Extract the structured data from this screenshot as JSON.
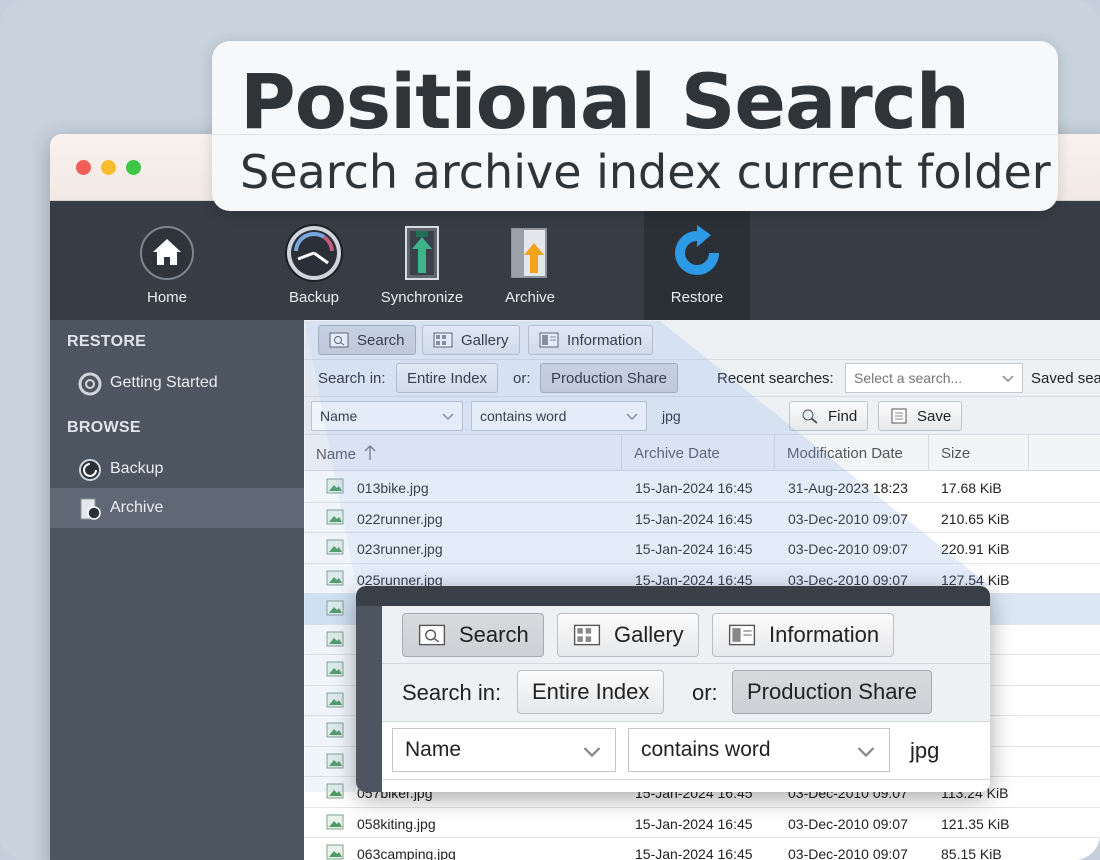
{
  "banner": {
    "title": "Positional Search",
    "subtitle": "Search archive index current folder"
  },
  "toolbar": {
    "items": [
      {
        "label": "Home",
        "icon": "home-icon"
      },
      {
        "label": "Backup",
        "icon": "backup-gauge-icon"
      },
      {
        "label": "Synchronize",
        "icon": "synchronize-icon"
      },
      {
        "label": "Archive",
        "icon": "archive-icon"
      },
      {
        "label": "Restore",
        "icon": "restore-icon"
      }
    ],
    "active": "Restore"
  },
  "sidebar": {
    "restore_heading": "RESTORE",
    "restore_items": [
      {
        "label": "Getting Started",
        "icon": "lifebuoy-icon"
      }
    ],
    "browse_heading": "BROWSE",
    "browse_items": [
      {
        "label": "Backup",
        "icon": "backup-restore-icon"
      },
      {
        "label": "Archive",
        "icon": "archive-restore-icon"
      }
    ],
    "selected": "Archive"
  },
  "tabs": {
    "search": "Search",
    "gallery": "Gallery",
    "information": "Information",
    "active": "Search"
  },
  "search_in": {
    "label": "Search in:",
    "entire_index": "Entire Index",
    "or_label": "or:",
    "production_share": "Production Share",
    "selected": "Production Share",
    "recent_label": "Recent searches:",
    "recent_placeholder": "Select a search...",
    "saved_label": "Saved sea"
  },
  "criteria": {
    "field": "Name",
    "operator": "contains word",
    "value": "jpg",
    "find_label": "Find",
    "save_label": "Save"
  },
  "table": {
    "columns": [
      "Name",
      "Archive Date",
      "Modification Date",
      "Size"
    ],
    "sort_column": "Name",
    "rows": [
      {
        "name": "013bike.jpg",
        "archive": "15-Jan-2024 16:45",
        "modified": "31-Aug-2023 18:23",
        "size": "17.68 KiB"
      },
      {
        "name": "022runner.jpg",
        "archive": "15-Jan-2024 16:45",
        "modified": "03-Dec-2010 09:07",
        "size": "210.65 KiB"
      },
      {
        "name": "023runner.jpg",
        "archive": "15-Jan-2024 16:45",
        "modified": "03-Dec-2010 09:07",
        "size": "220.91 KiB"
      },
      {
        "name": "025runner.jpg",
        "archive": "15-Jan-2024 16:45",
        "modified": "03-Dec-2010 09:07",
        "size": "127.54 KiB"
      },
      {
        "name": "",
        "archive": "",
        "modified": "",
        "size": "KiB",
        "selected": true
      },
      {
        "name": "",
        "archive": "",
        "modified": "",
        "size": "KiB"
      },
      {
        "name": "",
        "archive": "",
        "modified": "",
        "size": "KiB"
      },
      {
        "name": "",
        "archive": "",
        "modified": "",
        "size": "iB"
      },
      {
        "name": "",
        "archive": "",
        "modified": "",
        "size": "KiB"
      },
      {
        "name": "",
        "archive": "",
        "modified": "",
        "size": "KiB"
      },
      {
        "name": "057biker.jpg",
        "archive": "15-Jan-2024 16:45",
        "modified": "03-Dec-2010 09:07",
        "size": "113.24 KiB"
      },
      {
        "name": "058kiting.jpg",
        "archive": "15-Jan-2024 16:45",
        "modified": "03-Dec-2010 09:07",
        "size": "121.35 KiB"
      },
      {
        "name": "063camping.jpg",
        "archive": "15-Jan-2024 16:45",
        "modified": "03-Dec-2010 09:07",
        "size": "85.15 KiB"
      }
    ]
  },
  "colors": {
    "toolbar_bg": "#373d45",
    "sidebar_bg": "#4d5560",
    "selection": "#dbe7f5",
    "restore_blue": "#2d9ae8"
  }
}
